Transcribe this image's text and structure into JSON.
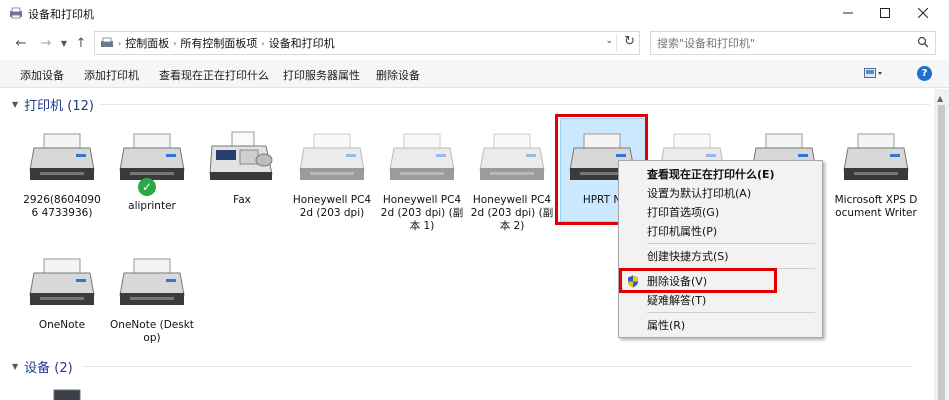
{
  "window": {
    "title": "设备和打印机",
    "controls": [
      "minimize",
      "maximize",
      "close"
    ]
  },
  "address": {
    "breadcrumbs": [
      "控制面板",
      "所有控制面板项",
      "设备和打印机"
    ],
    "search_placeholder": "搜索\"设备和打印机\""
  },
  "toolbar": {
    "commands": [
      "添加设备",
      "添加打印机",
      "查看现在正在打印什么",
      "打印服务器属性",
      "删除设备"
    ],
    "help": "?"
  },
  "groups": {
    "printers": {
      "title": "打印机 (12)"
    },
    "devices": {
      "title": "设备 (2)"
    }
  },
  "printers": [
    {
      "label": "2926(86040906 4733936)",
      "icon": "printer-icon"
    },
    {
      "label": "aliprinter",
      "icon": "printer-icon",
      "status": "default-checkmark"
    },
    {
      "label": "Fax",
      "icon": "fax-icon"
    },
    {
      "label": "Honeywell PC42d (203 dpi)",
      "icon": "printer-icon",
      "faded": true
    },
    {
      "label": "Honeywell PC42d (203 dpi) (副本 1)",
      "icon": "printer-icon",
      "faded": true
    },
    {
      "label": "Honeywell PC42d (203 dpi) (副本 2)",
      "icon": "printer-icon",
      "faded": true
    },
    {
      "label": "HPRT N",
      "icon": "printer-icon",
      "selected": true
    },
    {
      "label": "Microsoft XPS Document Writer",
      "icon": "printer-icon"
    },
    {
      "label": "OneNote",
      "icon": "printer-icon"
    },
    {
      "label": "OneNote (Desktop)",
      "icon": "printer-icon"
    }
  ],
  "context_menu": {
    "items": [
      {
        "label": "查看现在正在打印什么(E)",
        "bold": true
      },
      {
        "label": "设置为默认打印机(A)"
      },
      {
        "label": "打印首选项(G)"
      },
      {
        "label": "打印机属性(P)"
      },
      {
        "separator": true
      },
      {
        "label": "创建快捷方式(S)"
      },
      {
        "separator": true
      },
      {
        "label": "删除设备(V)",
        "icon": "shield-icon",
        "highlighted": true
      },
      {
        "label": "疑难解答(T)"
      },
      {
        "separator": true
      },
      {
        "label": "属性(R)"
      }
    ]
  },
  "colors": {
    "group_title": "#1e3c8c",
    "selection_bg": "#cce8ff",
    "annotation_red": "#e00000",
    "help_blue": "#1e6fd0"
  }
}
